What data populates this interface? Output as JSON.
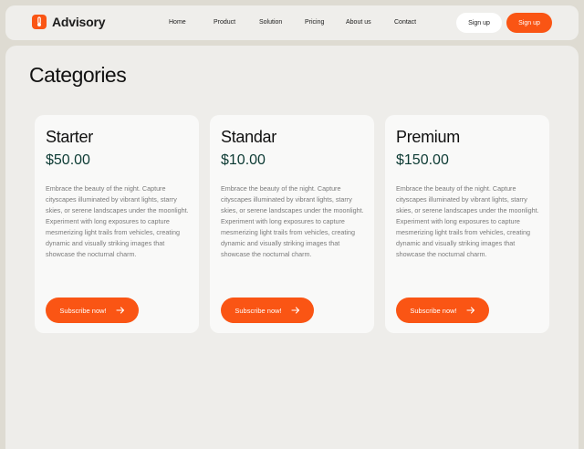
{
  "brand": {
    "name": "Advisory",
    "icon": "thermometer-icon",
    "accent": "#fa5514"
  },
  "nav": {
    "links": [
      "Home",
      "Product",
      "Solution",
      "Pricing",
      "About us",
      "Contact"
    ],
    "signin_label": "Sign up",
    "signup_label": "Sign up"
  },
  "page": {
    "heading": "Categories"
  },
  "plans": [
    {
      "name": "Starter",
      "price": "$50.00",
      "description": "Embrace the beauty of the night. Capture cityscapes illuminated by vibrant lights, starry skies, or serene landscapes under the moonlight. Experiment with long exposures to capture mesmerizing light trails from vehicles, creating dynamic and visually striking images that showcase the nocturnal charm.",
      "button": "Subscribe now!"
    },
    {
      "name": "Standar",
      "price": "$10.00",
      "description": "Embrace the beauty of the night. Capture cityscapes illuminated by vibrant lights, starry skies, or serene landscapes under the moonlight. Experiment with long exposures to capture mesmerizing light trails from vehicles, creating dynamic and visually striking images that showcase the nocturnal charm.",
      "button": "Subscribe now!"
    },
    {
      "name": "Premium",
      "price": "$150.00",
      "description": "Embrace the beauty of the night. Capture cityscapes illuminated by vibrant lights, starry skies, or serene landscapes under the moonlight. Experiment with long exposures to capture mesmerizing light trails from vehicles, creating dynamic and visually striking images that showcase the nocturnal charm.",
      "button": "Subscribe now!"
    }
  ],
  "colors": {
    "accent": "#fa5514",
    "price": "#0d3b34",
    "background": "#dedbd2"
  }
}
